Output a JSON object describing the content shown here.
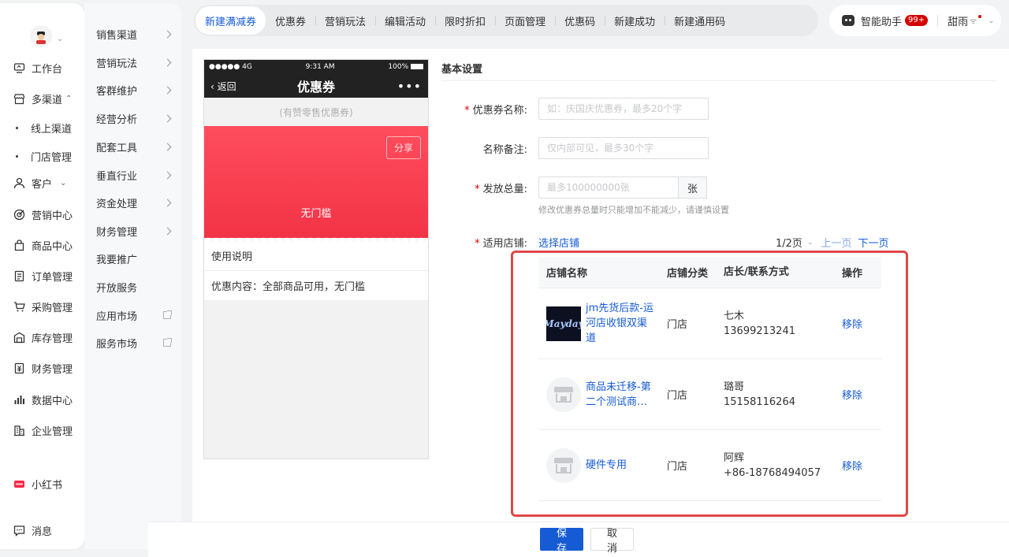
{
  "nav_primary": {
    "items": [
      {
        "label": "工作台"
      },
      {
        "label": "多渠道"
      },
      {
        "label": "线上渠道"
      },
      {
        "label": "门店管理"
      },
      {
        "label": "客户"
      },
      {
        "label": "营销中心"
      },
      {
        "label": "商品中心"
      },
      {
        "label": "订单管理"
      },
      {
        "label": "采购管理"
      },
      {
        "label": "库存管理"
      },
      {
        "label": "财务管理"
      },
      {
        "label": "数据中心"
      },
      {
        "label": "企业管理"
      },
      {
        "label": "小红书"
      },
      {
        "label": "消息"
      }
    ]
  },
  "nav_secondary": {
    "items": [
      {
        "label": "销售渠道"
      },
      {
        "label": "营销玩法"
      },
      {
        "label": "客群维护"
      },
      {
        "label": "经营分析"
      },
      {
        "label": "配套工具"
      },
      {
        "label": "垂直行业"
      },
      {
        "label": "资金处理"
      },
      {
        "label": "财务管理"
      },
      {
        "label": "我要推广"
      },
      {
        "label": "开放服务"
      },
      {
        "label": "应用市场"
      },
      {
        "label": "服务市场"
      }
    ]
  },
  "tabs": [
    {
      "label": "新建满减券"
    },
    {
      "label": "优惠券"
    },
    {
      "label": "营销玩法"
    },
    {
      "label": "编辑活动"
    },
    {
      "label": "限时折扣"
    },
    {
      "label": "页面管理"
    },
    {
      "label": "优惠码"
    },
    {
      "label": "新建成功"
    },
    {
      "label": "新建通用码"
    }
  ],
  "topright": {
    "assistant": "智能助手",
    "badge": "99+",
    "user": "甜雨"
  },
  "phone": {
    "carrier": "●●●●● 4G",
    "time": "9:31 AM",
    "battery": "100%",
    "back": "返回",
    "title": "优惠券",
    "more": "•••",
    "shop_type": "(有赞零售优惠券)",
    "share": "分享",
    "threshold": "无门槛",
    "usage_title": "使用说明",
    "usage_content": "优惠内容：全部商品可用，无门槛"
  },
  "form": {
    "section_title": "基本设置",
    "name_label": "优惠券名称:",
    "name_placeholder": "如：庆国庆优惠券，最多20个字",
    "remark_label": "名称备注:",
    "remark_placeholder": "仅内部可见，最多30个字",
    "total_label": "发放总量:",
    "total_placeholder": "最多100000000张",
    "total_unit": "张",
    "total_hint": "修改优惠券总量时只能增加不能减少，请谨慎设置",
    "stores_label": "适用店铺:",
    "select_store": "选择店铺",
    "page_info": "1/2页",
    "prev": "上一页",
    "next": "下一页"
  },
  "table": {
    "headers": [
      "店铺名称",
      "店铺分类",
      "店长/联系方式",
      "操作"
    ],
    "rows": [
      {
        "thumb_text": "Mayday",
        "name": "jm先货后款-运河店收银双渠道",
        "type": "门店",
        "manager": "七木",
        "phone": "13699213241",
        "action": "移除"
      },
      {
        "thumb_text": "",
        "name": "商品未迁移-第二个测试商城...",
        "type": "门店",
        "manager": "璐哥",
        "phone": "15158116264",
        "action": "移除"
      },
      {
        "thumb_text": "",
        "name": "硬件专用",
        "type": "门店",
        "manager": "阿辉",
        "phone": "+86-18768494057",
        "action": "移除"
      }
    ]
  },
  "footer": {
    "save": "保存",
    "cancel": "取消"
  },
  "colors": {
    "primary": "#155bd4",
    "danger": "#d40000",
    "coupon_red": "#f23346",
    "highlight": "#e04848"
  }
}
